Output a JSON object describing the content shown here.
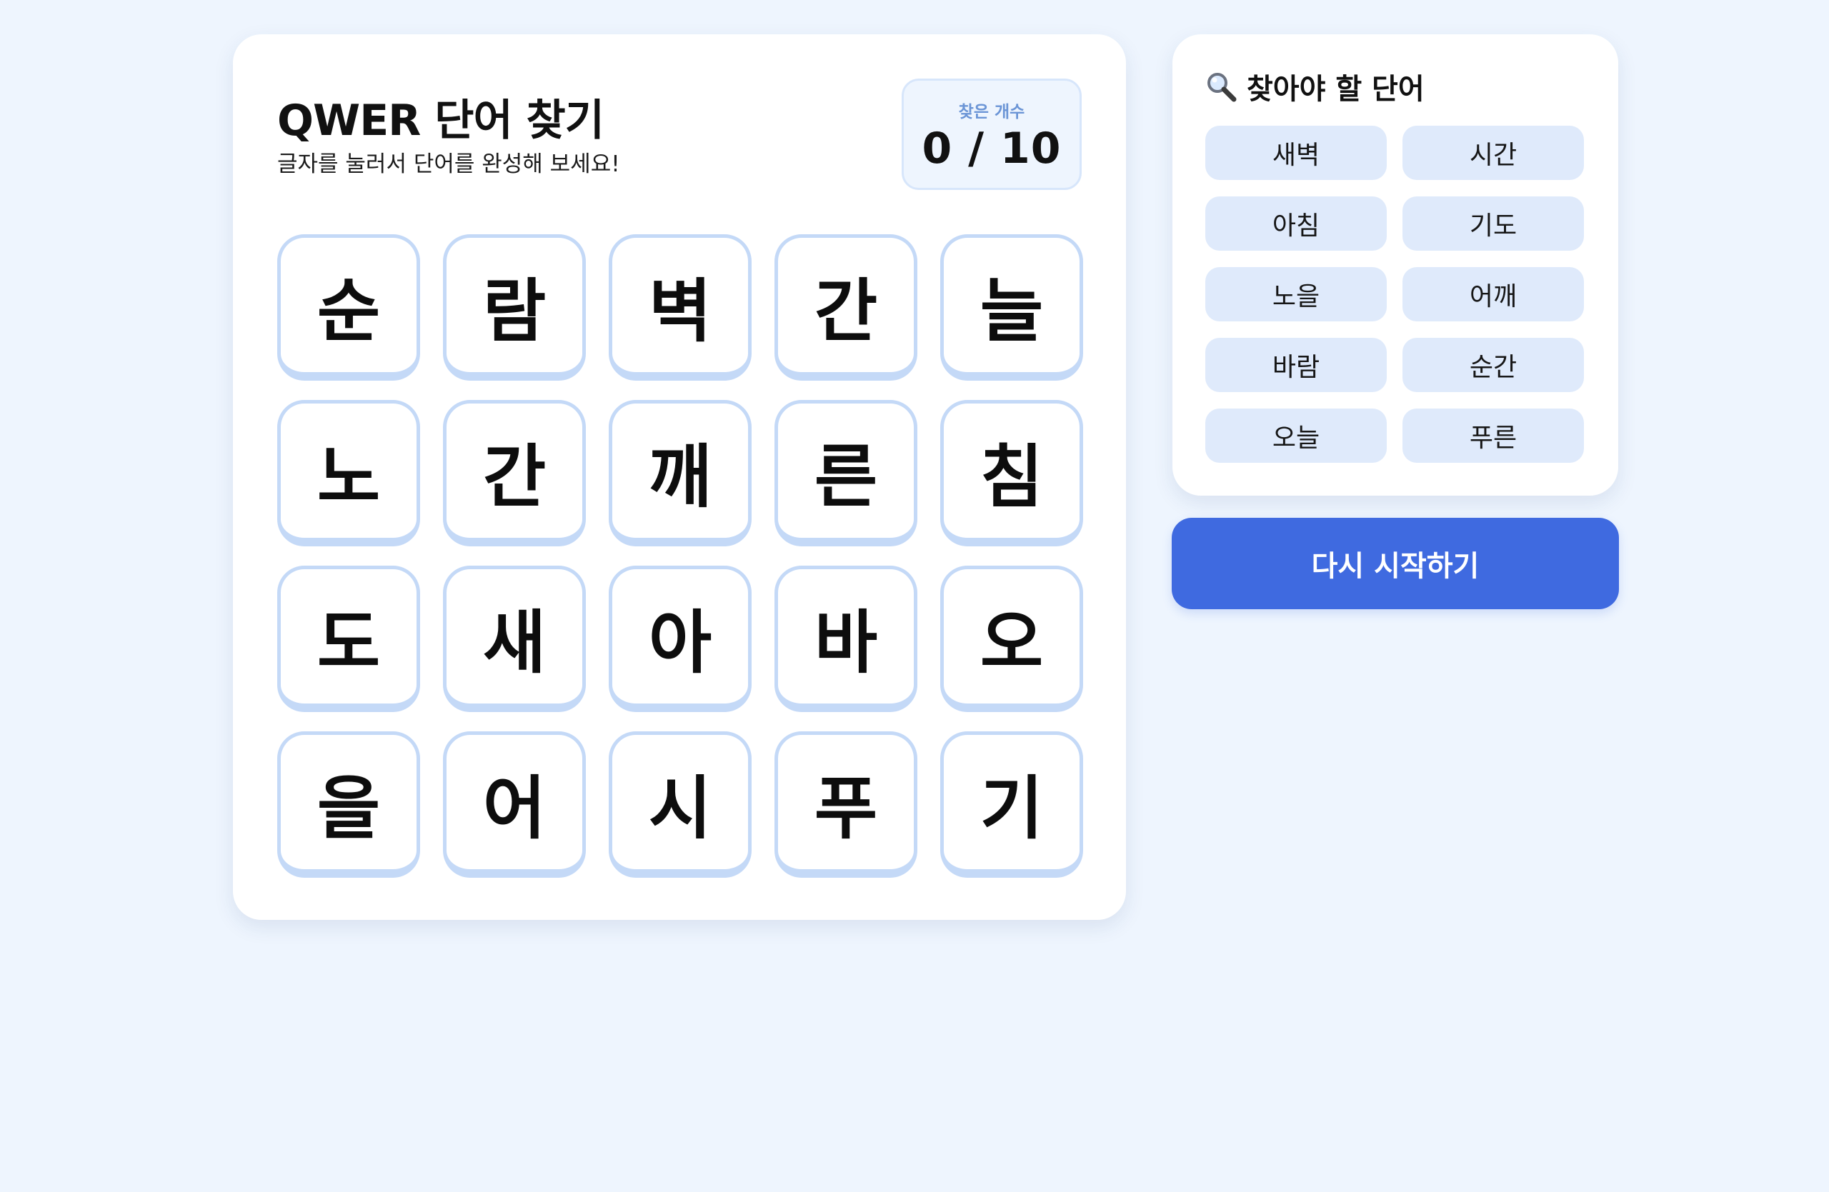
{
  "board": {
    "title": "QWER 단어 찾기",
    "subtitle": "글자를 눌러서 단어를 완성해 보세요!",
    "score": {
      "label": "찾은 개수",
      "value": "0 / 10"
    },
    "tiles": [
      "순",
      "람",
      "벽",
      "간",
      "늘",
      "노",
      "간",
      "깨",
      "른",
      "침",
      "도",
      "새",
      "아",
      "바",
      "오",
      "을",
      "어",
      "시",
      "푸",
      "기"
    ]
  },
  "word_list": {
    "icon": "magnifying-glass-icon",
    "title": "찾아야 할 단어",
    "words": [
      "새벽",
      "시간",
      "아침",
      "기도",
      "노을",
      "어깨",
      "바람",
      "순간",
      "오늘",
      "푸른"
    ]
  },
  "restart_button": {
    "label": "다시 시작하기"
  },
  "colors": {
    "background": "#eef5fe",
    "tile_border": "#c4d9f7",
    "chip_background": "#dfeafb",
    "accent": "#3f6ae0",
    "score_label": "#6b95d6"
  }
}
